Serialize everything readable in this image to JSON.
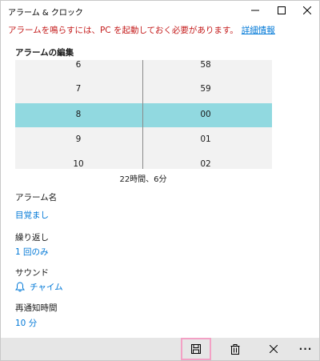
{
  "window": {
    "title": "アラーム & クロック"
  },
  "warning": {
    "text": "アラームを鳴らすには、PC を起動しておく必要があります。",
    "link": "詳細情報"
  },
  "editor": {
    "title": "アラームの編集",
    "hours": [
      "6",
      "7",
      "8",
      "9",
      "10"
    ],
    "minutes": [
      "58",
      "59",
      "00",
      "01",
      "02"
    ],
    "selected_hour": "8",
    "selected_minute": "00",
    "selection_color": "#91d9e0",
    "duration": "22時間、6分"
  },
  "fields": {
    "name_label": "アラーム名",
    "name_value": "目覚まし",
    "repeat_label": "繰り返し",
    "repeat_value": "1 回のみ",
    "sound_label": "サウンド",
    "sound_icon": "bell-icon",
    "sound_value": "チャイム",
    "snooze_label": "再通知時間",
    "snooze_value": "10 分"
  },
  "commands": {
    "save_icon": "save-icon",
    "delete_icon": "trash-icon",
    "close_icon": "close-icon",
    "more_label": "···"
  },
  "colors": {
    "warning": "#c41b1b",
    "accent": "#0078d7",
    "command_bar": "#e6e6e6",
    "save_highlight": "#f3a1c5"
  }
}
